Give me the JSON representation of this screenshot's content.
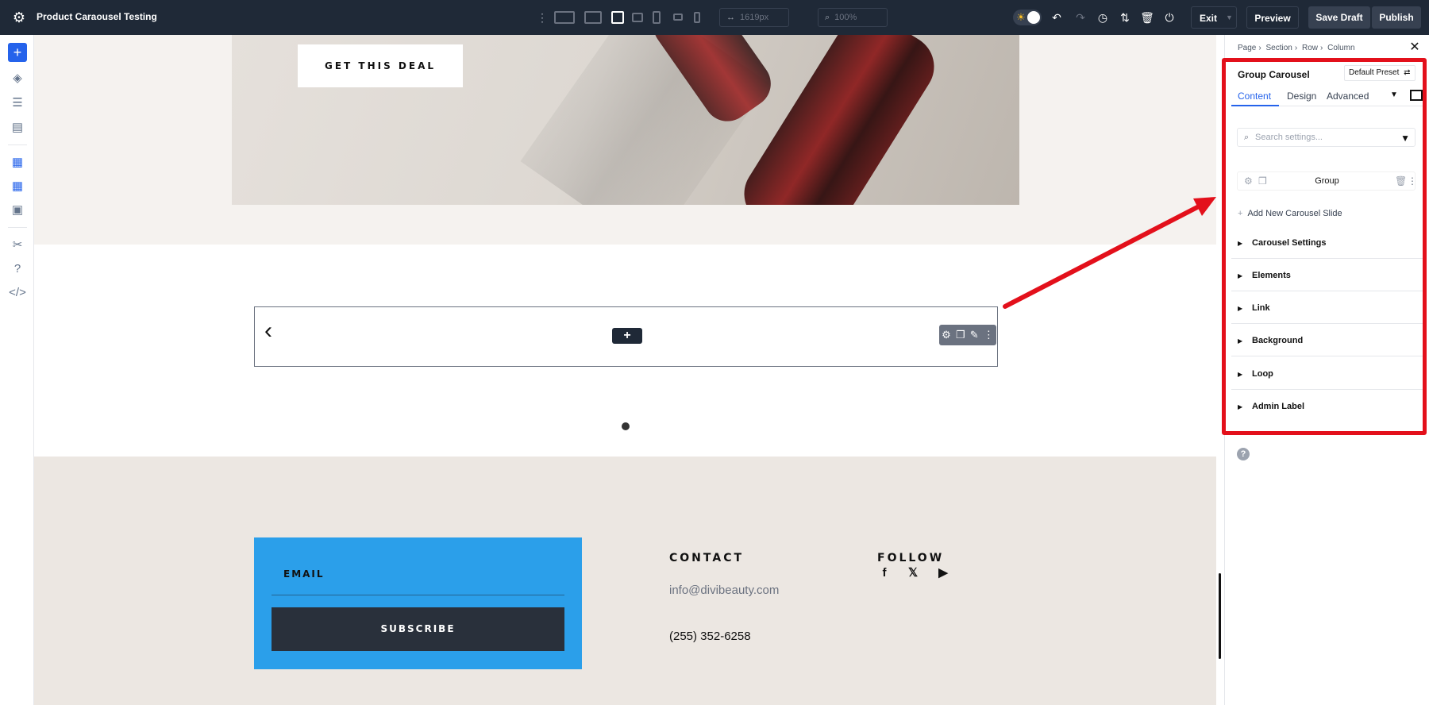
{
  "topbar": {
    "title": "Product Caraousel Testing",
    "width_value": "1619px",
    "zoom_value": "100%",
    "exit_label": "Exit",
    "preview_label": "Preview",
    "save_label": "Save Draft",
    "publish_label": "Publish"
  },
  "hero": {
    "cta_label": "GET THIS DEAL"
  },
  "carousel": {
    "prev_glyph": "‹",
    "next_glyph": "›",
    "add_glyph": "+"
  },
  "footer": {
    "email_label": "EMAIL",
    "subscribe_label": "SUBSCRIBE",
    "contact_heading": "CONTACT",
    "contact_email": "info@divibeauty.com",
    "contact_phone": "(255) 352-6258",
    "follow_heading": "FOLLOW",
    "social": [
      "facebook-icon",
      "x-icon",
      "youtube-icon"
    ]
  },
  "panel": {
    "breadcrumb": [
      "Page",
      "Section",
      "Row",
      "Column"
    ],
    "module_title": "Group Carousel",
    "preset_label": "Default Preset",
    "tabs": [
      "Content",
      "Design",
      "Advanced"
    ],
    "search_placeholder": "Search settings...",
    "group_label": "Group",
    "add_slide_label": "Add New Carousel Slide",
    "sections": [
      "Carousel Settings",
      "Elements",
      "Link",
      "Background",
      "Loop",
      "Admin Label"
    ]
  },
  "colors": {
    "accent_blue": "#2563eb",
    "highlight_red": "#e3101b",
    "topbar_bg": "#1f2937",
    "signup_blue": "#2b9fea",
    "footer_bg": "#ece7e2"
  }
}
